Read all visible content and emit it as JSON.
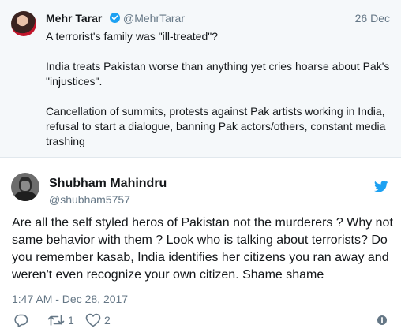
{
  "parent_tweet": {
    "author_name": "Mehr Tarar",
    "author_handle": "@MehrTarar",
    "date": "26 Dec",
    "paragraphs": [
      "A terrorist's family was \"ill-treated\"?",
      "India treats Pakistan worse than anything yet cries hoarse about Pak's \"injustices\".",
      "Cancellation of summits, protests against Pak artists working in India, refusal to start a dialogue, banning Pak actors/others, constant media trashing"
    ]
  },
  "tweet": {
    "author_name": "Shubham Mahindru",
    "author_handle": "@shubham5757",
    "text": "Are all the self styled heros of Pakistan not the murderers ? Why not same behavior with them ? Look who is talking about terrorists? Do you remember kasab, India identifies her citizens you ran away and weren't even recognize your own citizen. Shame shame",
    "timestamp": "1:47 AM - Dec 28, 2017",
    "reply_count": "",
    "retweet_count": "1",
    "like_count": "2"
  },
  "icons": {
    "verified": "verified-badge-icon",
    "brand": "twitter-bird-icon",
    "reply": "reply-icon",
    "retweet": "retweet-icon",
    "like": "heart-icon",
    "info": "info-icon"
  },
  "colors": {
    "brand_blue": "#1da1f2",
    "secondary_text": "#657786",
    "quoted_background": "#f5f8fa"
  }
}
